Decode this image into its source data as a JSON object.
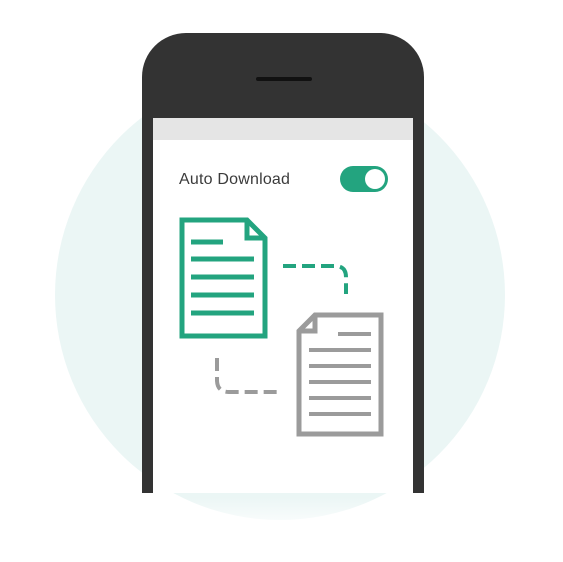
{
  "setting": {
    "label": "Auto Download",
    "toggle_on": true
  },
  "icons": {
    "source": "document-icon",
    "target": "document-icon"
  },
  "colors": {
    "accent": "#23a47f",
    "phone_body": "#333333",
    "doc_gray": "#9b9b9b",
    "circle_bg": "#ebf6f5"
  }
}
